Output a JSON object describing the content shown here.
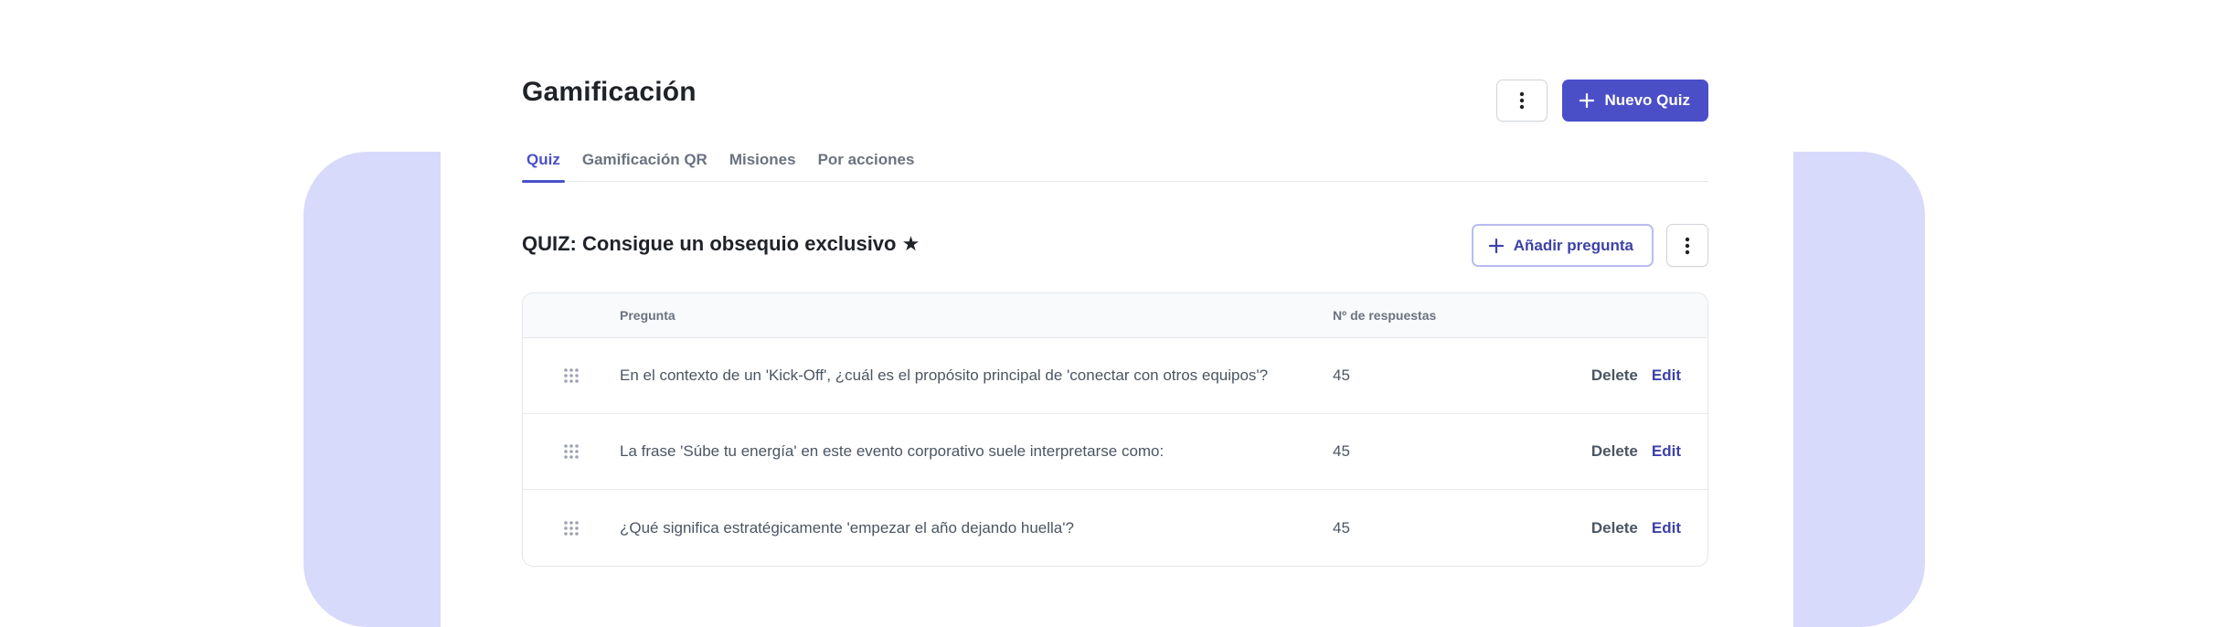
{
  "page": {
    "title": "Gamificación"
  },
  "header": {
    "more_icon": "vertical-dots-icon",
    "new_quiz_label": "Nuevo Quiz",
    "plus_icon": "plus-icon"
  },
  "tabs": [
    {
      "label": "Quiz",
      "active": true
    },
    {
      "label": "Gamificación QR",
      "active": false
    },
    {
      "label": "Misiones",
      "active": false
    },
    {
      "label": "Por acciones",
      "active": false
    }
  ],
  "quiz": {
    "title": "QUIZ: Consigue un obsequio exclusivo ★",
    "add_question_label": "Añadir pregunta"
  },
  "table": {
    "columns": {
      "question": "Pregunta",
      "responses": "Nº de respuestas"
    },
    "rows": [
      {
        "question": "En el contexto de un 'Kick-Off', ¿cuál es el propósito principal de 'conectar con otros equipos'?",
        "responses": "45",
        "delete": "Delete",
        "edit": "Edit"
      },
      {
        "question": "La frase 'Súbe tu energía' en este evento corporativo suele interpretarse como:",
        "responses": "45",
        "delete": "Delete",
        "edit": "Edit"
      },
      {
        "question": "¿Qué significa estratégicamente 'empezar el año dejando huella'?",
        "responses": "45",
        "delete": "Delete",
        "edit": "Edit"
      }
    ]
  },
  "colors": {
    "accent": "#4a4fc8",
    "background_panel": "#d8dafb"
  }
}
